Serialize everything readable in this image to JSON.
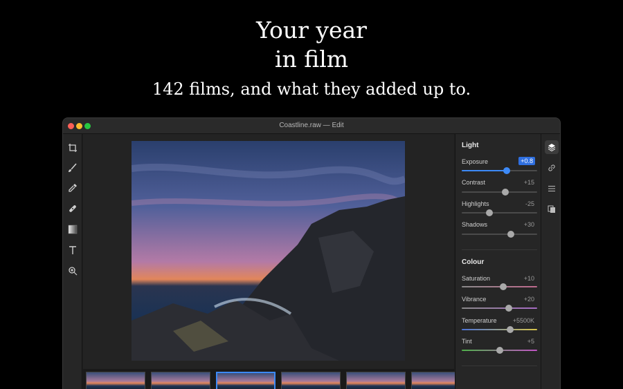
{
  "hero": {
    "title_line1": "Your year",
    "title_line2": "in film",
    "subtitle": "142 films, and what they added up to."
  },
  "window": {
    "title": "Coastline.raw — Edit"
  },
  "tools": [
    "crop-icon",
    "brush-icon",
    "eyedropper-icon",
    "healing-icon",
    "gradient-icon",
    "text-icon",
    "zoom-icon"
  ],
  "panel": {
    "light": {
      "title": "Light",
      "sliders": [
        {
          "label": "Exposure",
          "value": "+0.8",
          "level": 0.6
        },
        {
          "label": "Contrast",
          "value": "+15",
          "level": 0.58
        },
        {
          "label": "Highlights",
          "value": "-25",
          "level": 0.37
        },
        {
          "label": "Shadows",
          "value": "+30",
          "level": 0.65
        }
      ]
    },
    "colour": {
      "title": "Colour",
      "sliders": [
        {
          "label": "Saturation",
          "value": "+10",
          "level": 0.55
        },
        {
          "label": "Vibrance",
          "value": "+20",
          "level": 0.62
        },
        {
          "label": "Temperature",
          "value": "+5500K",
          "level": 0.64
        },
        {
          "label": "Tint",
          "value": "+5",
          "level": 0.5
        }
      ]
    }
  },
  "rail": [
    "layers-icon",
    "link-icon",
    "list-icon",
    "copy-icon"
  ],
  "filmstrip": {
    "count": 6,
    "active_index": 2
  },
  "colors": {
    "accent": "#3d8af7",
    "value_badge": "#2f6fe0"
  }
}
